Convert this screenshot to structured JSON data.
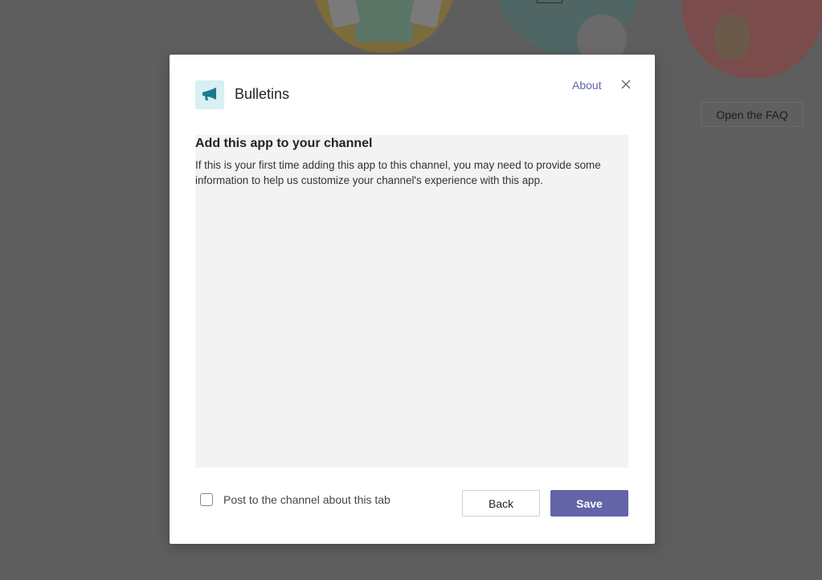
{
  "background": {
    "faq_button_label": "Open the FAQ"
  },
  "dialog": {
    "app_name": "Bulletins",
    "app_icon": "megaphone-icon",
    "about_label": "About",
    "close_icon": "close-icon",
    "content": {
      "heading": "Add this app to your channel",
      "body": "If this is your first time adding this app to this channel, you may need to provide some information to help us customize your channel's experience with this app."
    },
    "post_checkbox": {
      "label": "Post to the channel about this tab",
      "checked": false
    },
    "back_label": "Back",
    "save_label": "Save"
  },
  "colors": {
    "accent": "#6264a7",
    "overlay": "#5e5e5e",
    "content_bg": "#f3f3f3",
    "icon_bg": "#d8f0f1",
    "icon_fg": "#1b7a8f"
  }
}
